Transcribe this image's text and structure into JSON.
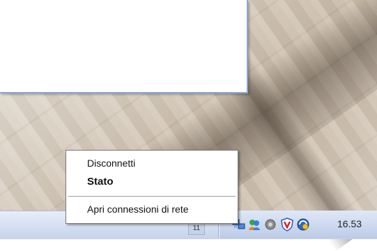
{
  "context_menu": {
    "items": [
      {
        "label": "Disconnetti"
      },
      {
        "label": "Stato",
        "default": true
      },
      {
        "label": "Apri connessioni di rete"
      }
    ]
  },
  "taskbar": {
    "button_label": "11",
    "tray_icons": [
      "network-connection-icon",
      "messenger-icon",
      "volume-icon",
      "antivirus-shield-icon",
      "security-update-icon"
    ],
    "clock": "16.53"
  },
  "colors": {
    "taskbar": "#d9e3f3",
    "menu_background": "#ffffff",
    "window_border": "#8aa6d6"
  }
}
